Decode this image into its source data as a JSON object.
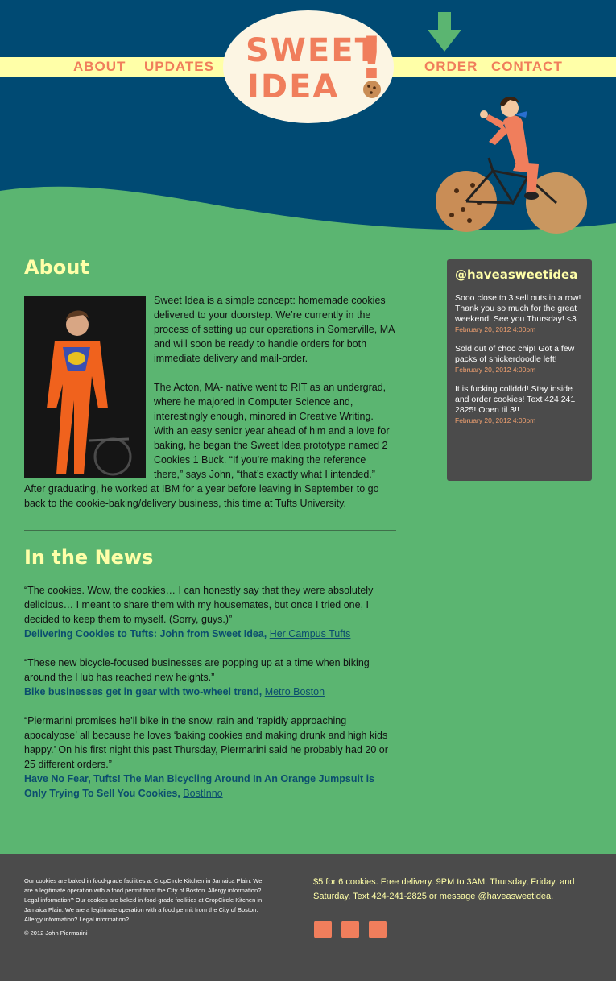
{
  "nav": {
    "about": "ABOUT",
    "updates": "UPDATES",
    "order": "ORDER",
    "contact": "CONTACT"
  },
  "logo": {
    "line1": "SWEET",
    "line2": "IDEA",
    "exclaim": "!"
  },
  "about": {
    "heading": "About",
    "p1": "Sweet Idea is a simple concept: homemade cookies delivered to your doorstep. We’re currently in the process of setting up our operations in Somerville, MA and will soon be ready to handle orders for both immediate delivery and mail-order.",
    "p2": "The Acton, MA- native went to RIT as an undergrad, where he majored in Computer Science and, interestingly enough, minored in Creative Writing. With an easy senior year ahead of him and a love for baking, he began the Sweet Idea prototype named 2 Cookies 1 Buck.  “If you’re making the reference there,” says John, “that’s exactly what I intended.” After graduating, he worked at IBM for a year before leaving in September to go back to the cookie-baking/delivery business, this time at Tufts University."
  },
  "news": {
    "heading": "In the News",
    "items": [
      {
        "quote": "“The cookies.  Wow, the cookies… I can honestly say that they were absolutely delicious… I meant to share them with my housemates, but once I tried one, I decided to keep them to myself.  (Sorry, guys.)”",
        "link": "Delivering Cookies to Tufts: John from Sweet Idea,",
        "source": "Her Campus Tufts"
      },
      {
        "quote": "“These new bicycle-focused businesses are popping up at a time when biking around the Hub has reached new heights.”",
        "link": "Bike businesses get in gear with two-wheel trend,",
        "source": "Metro Boston"
      },
      {
        "quote": "“Piermarini promises he’ll bike in the snow, rain and ‘rapidly approaching apocalypse’ all because he loves ‘baking cookies and making drunk and high kids happy.’ On his first night this past Thursday, Piermarini said he probably had 20 or 25 different orders.”",
        "link": "Have No Fear, Tufts! The Man Bicycling Around In An Orange Jumpsuit is Only Trying To Sell You Cookies,",
        "source": "BostInno"
      }
    ]
  },
  "twitter": {
    "handle": "@haveasweetidea",
    "tweets": [
      {
        "text": "Sooo close to 3 sell outs in a row! Thank you so much for the great weekend! See you Thursday! <3",
        "date": "February 20, 2012 4:00pm"
      },
      {
        "text": "Sold out of choc chip! Got a few packs of snickerdoodle left!",
        "date": "February 20, 2012 4:00pm"
      },
      {
        "text": "It is fucking collddd! Stay inside and order cookies! Text 424 241 2825! Open til 3!!",
        "date": "February 20, 2012 4:00pm"
      }
    ]
  },
  "footer": {
    "legal": "Our cookies are baked in food-grade facilities at CropCircle Kitchen in Jamaica Plain. We are a legitimate operation with a food permit from the City of Boston. Allergy information? Legal information? Our cookies are baked in food-grade facilities at CropCircle Kitchen in Jamaica Plain. We are a legitimate operation with a food permit from the City of Boston. Allergy information? Legal information?",
    "copyright": "© 2012 John Piermarini",
    "info": "$5 for 6 cookies. Free delivery. 9PM to 3AM. Thursday, Friday, and Saturday. Text 424-241-2825 or message @haveasweetidea."
  },
  "colors": {
    "navy": "#004a73",
    "green": "#5bb571",
    "cream": "#ffffa8",
    "coral": "#f07e5c",
    "panel": "#4b4b4b",
    "link": "#0b4d6e"
  }
}
